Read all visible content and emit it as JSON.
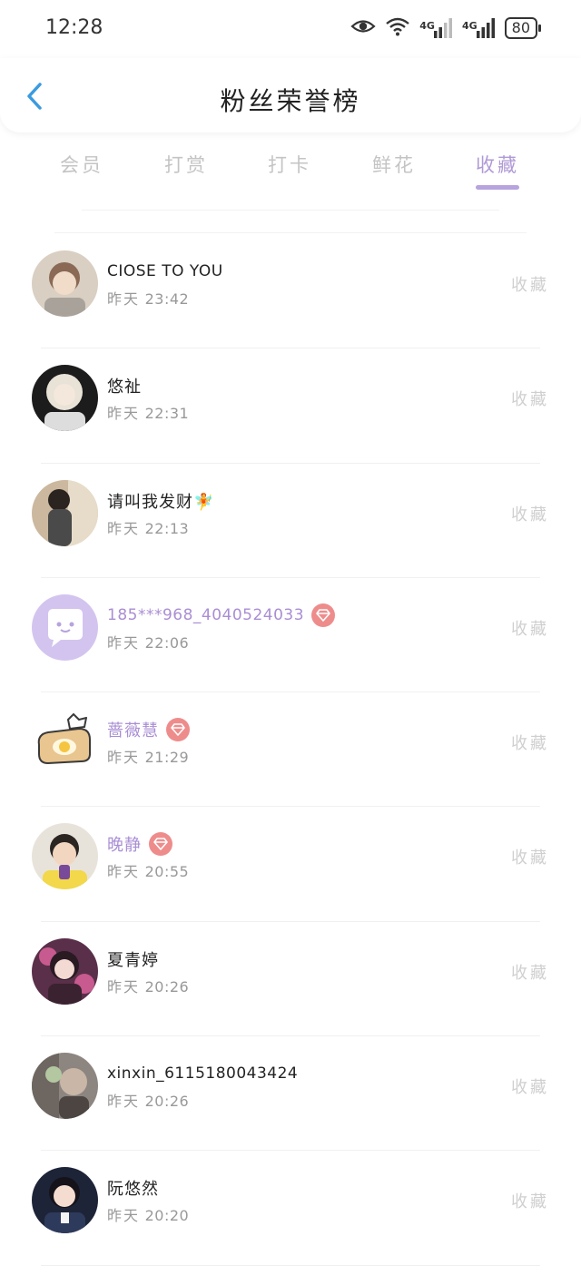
{
  "status_bar": {
    "time": "12:28",
    "network_1": "4G",
    "network_2": "4G",
    "battery": "80"
  },
  "header": {
    "title": "粉丝荣誉榜"
  },
  "tabs": [
    {
      "label": "会员"
    },
    {
      "label": "打赏"
    },
    {
      "label": "打卡"
    },
    {
      "label": "鲜花"
    },
    {
      "label": "收藏"
    }
  ],
  "active_tab": "收藏",
  "rows": [
    {
      "name": "CIOSE TO YOU",
      "date": "昨天",
      "time": "23:42",
      "action": "收藏"
    },
    {
      "name": "悠祉",
      "date": "昨天",
      "time": "22:31",
      "action": "收藏"
    },
    {
      "name": "请叫我发财🧚",
      "date": "昨天",
      "time": "22:13",
      "action": "收藏"
    },
    {
      "name": "185***968_4040524033",
      "date": "昨天",
      "time": "22:06",
      "action": "收藏"
    },
    {
      "name": "蔷薇慧",
      "date": "昨天",
      "time": "21:29",
      "action": "收藏"
    },
    {
      "name": "晚静",
      "date": "昨天",
      "time": "20:55",
      "action": "收藏"
    },
    {
      "name": "夏青婷",
      "date": "昨天",
      "time": "20:26",
      "action": "收藏"
    },
    {
      "name": "xinxin_6115180043424",
      "date": "昨天",
      "time": "20:26",
      "action": "收藏"
    },
    {
      "name": "阮悠然",
      "date": "昨天",
      "time": "20:20",
      "action": "收藏"
    }
  ],
  "colors": {
    "accent": "#b09ad6",
    "vip_name": "#a98ed4",
    "vip_badge": "#ee8c8c",
    "back_arrow": "#3a9be0"
  }
}
